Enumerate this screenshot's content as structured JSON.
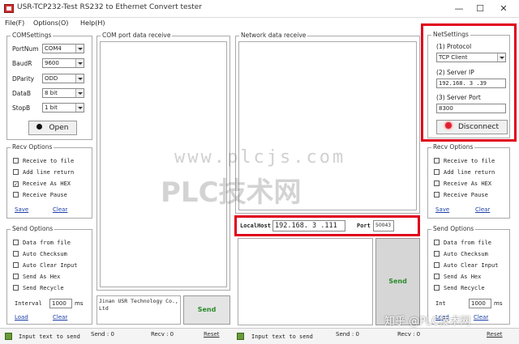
{
  "window": {
    "title": "USR-TCP232-Test  RS232 to Ethernet Convert tester",
    "minimize": "—",
    "maximize": "☐",
    "close": "✕"
  },
  "menu": [
    "File(F)",
    "Options(O)",
    "Help(H)"
  ],
  "com_settings": {
    "title": "COMSettings",
    "port_label": "PortNum",
    "port_value": "COM4",
    "baud_label": "BaudR",
    "baud_value": "9600",
    "parity_label": "DParity",
    "parity_value": "ODD",
    "databits_label": "DataB",
    "databits_value": "8 bit",
    "stopbits_label": "StopB",
    "stopbits_value": "1 bit",
    "open_button": "Open"
  },
  "com_receive": {
    "title": "COM port data receive"
  },
  "net_receive": {
    "title": "Network data receive"
  },
  "net_settings": {
    "title": "NetSettings",
    "protocol_label": "(1) Protocol",
    "protocol_value": "TCP Client",
    "server_ip_label": "(2) Server IP",
    "server_ip_value": "192.168. 3 .39",
    "server_port_label": "(3) Server Port",
    "server_port_value": "8300",
    "disconnect_button": "Disconnect"
  },
  "left_recv_options": {
    "title": "Recv Options",
    "items": [
      {
        "label": "Receive to file",
        "checked": false
      },
      {
        "label": "Add line return",
        "checked": false
      },
      {
        "label": "Receive As HEX",
        "checked": true
      },
      {
        "label": "Receive Pause",
        "checked": false
      }
    ],
    "save": "Save",
    "clear": "Clear"
  },
  "right_recv_options": {
    "title": "Recv Options",
    "items": [
      {
        "label": "Receive to file",
        "checked": false
      },
      {
        "label": "Add line return",
        "checked": false
      },
      {
        "label": "Receive As HEX",
        "checked": false
      },
      {
        "label": "Receive Pause",
        "checked": false
      }
    ],
    "save": "Save",
    "clear": "Clear"
  },
  "left_send_options": {
    "title": "Send Options",
    "items": [
      {
        "label": "Data from file",
        "checked": false
      },
      {
        "label": "Auto Checksum",
        "checked": false
      },
      {
        "label": "Auto Clear Input",
        "checked": false
      },
      {
        "label": "Send As Hex",
        "checked": false
      },
      {
        "label": "Send Recycle",
        "checked": false
      }
    ],
    "interval_label": "Interval",
    "interval_value": "1000",
    "interval_unit": "ms",
    "load": "Load",
    "clear": "Clear"
  },
  "right_send_options": {
    "title": "Send Options",
    "items": [
      {
        "label": "Data from file",
        "checked": false
      },
      {
        "label": "Auto Checksum",
        "checked": false
      },
      {
        "label": "Auto Clear Input",
        "checked": false
      },
      {
        "label": "Send As Hex",
        "checked": false
      },
      {
        "label": "Send Recycle",
        "checked": false
      }
    ],
    "interval_label": "Int",
    "interval_value": "1000",
    "interval_unit": "ms",
    "load": "Load",
    "clear": "Clear"
  },
  "local": {
    "host_label": "LocalHost",
    "host_value": "192.168. 3 .111",
    "port_label": "Port",
    "port_value": "50043"
  },
  "com_send": {
    "text": "Jinan USR Technology Co., Ltd",
    "button": "Send"
  },
  "net_send": {
    "button": "Send"
  },
  "status_left": {
    "hint": "Input text to send",
    "send_label": "Send : 0",
    "recv_label": "Recv : 0",
    "reset": "Reset"
  },
  "status_right": {
    "hint": "Input text to send",
    "send_label": "Send : 0",
    "recv_label": "Recv : 0",
    "reset": "Reset"
  },
  "watermarks": {
    "url": "www.plcjs.com",
    "brand": "PLC技术网",
    "zhihu": "知乎 @PLC技术网"
  }
}
